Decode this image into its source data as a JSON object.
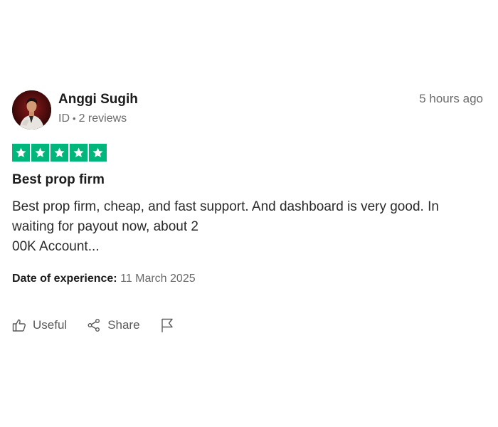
{
  "review": {
    "reviewer_name": "Anggi Sugih",
    "country_code": "ID",
    "separator": "•",
    "review_count": "2 reviews",
    "time_ago": "5 hours ago",
    "rating": 5,
    "rating_color": "#00b67a",
    "title": "Best prop firm",
    "body_lines": [
      "Best prop firm, cheap, and fast support. And dashboard is very good. In",
      "waiting for payout now, about 2",
      "00K Account..."
    ],
    "experience_label": "Date of experience:",
    "experience_date": "11 March 2025"
  },
  "actions": {
    "useful_label": "Useful",
    "share_label": "Share",
    "useful_icon": "thumbs-up-icon",
    "share_icon": "share-icon",
    "report_icon": "flag-icon"
  }
}
